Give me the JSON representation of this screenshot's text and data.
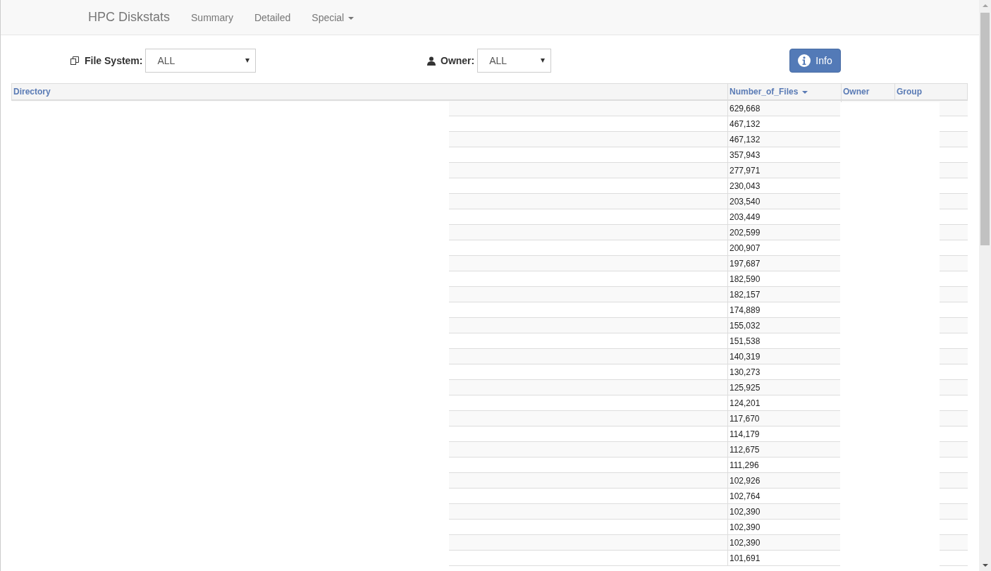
{
  "navbar": {
    "brand": "HPC Diskstats",
    "items": [
      {
        "label": "Summary",
        "kind": "link"
      },
      {
        "label": "Detailed",
        "kind": "link"
      },
      {
        "label": "Special",
        "kind": "dropdown"
      }
    ]
  },
  "filters": {
    "file_system": {
      "label": "File System:",
      "value": "ALL"
    },
    "owner": {
      "label": "Owner:",
      "value": "ALL"
    },
    "info_button": "Info"
  },
  "table": {
    "columns": [
      {
        "label": "Directory",
        "sorted": false
      },
      {
        "label": "Number_of_Files",
        "sorted": true
      },
      {
        "label": "Owner",
        "sorted": false
      },
      {
        "label": "Group",
        "sorted": false
      }
    ],
    "rows": [
      "629,668",
      "467,132",
      "467,132",
      "357,943",
      "277,971",
      "230,043",
      "203,540",
      "203,449",
      "202,599",
      "200,907",
      "197,687",
      "182,590",
      "182,157",
      "174,889",
      "155,032",
      "151,538",
      "140,319",
      "130,273",
      "125,925",
      "124,201",
      "117,670",
      "114,179",
      "112,675",
      "111,296",
      "102,926",
      "102,764",
      "102,390",
      "102,390",
      "102,390",
      "101,691"
    ]
  }
}
